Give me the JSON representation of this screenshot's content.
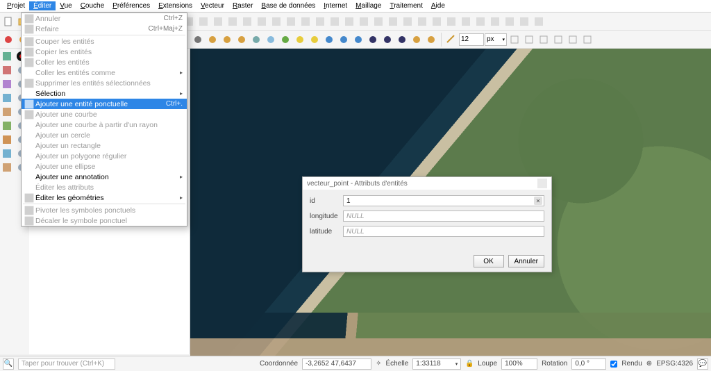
{
  "menubar": [
    {
      "label": "Projet",
      "active": false
    },
    {
      "label": "Éditer",
      "active": true
    },
    {
      "label": "Vue",
      "active": false
    },
    {
      "label": "Couche",
      "active": false
    },
    {
      "label": "Préférences",
      "active": false
    },
    {
      "label": "Extensions",
      "active": false
    },
    {
      "label": "Vecteur",
      "active": false
    },
    {
      "label": "Raster",
      "active": false
    },
    {
      "label": "Base de données",
      "active": false
    },
    {
      "label": "Internet",
      "active": false
    },
    {
      "label": "Maillage",
      "active": false
    },
    {
      "label": "Traitement",
      "active": false
    },
    {
      "label": "Aide",
      "active": false
    }
  ],
  "dropdown": {
    "items": [
      {
        "label": "Annuler",
        "shortcut": "Ctrl+Z",
        "disabled": true,
        "icon": "undo"
      },
      {
        "label": "Refaire",
        "shortcut": "Ctrl+Maj+Z",
        "disabled": true,
        "icon": "redo"
      },
      {
        "type": "sep"
      },
      {
        "label": "Couper les entités",
        "disabled": true,
        "icon": "cut"
      },
      {
        "label": "Copier les entités",
        "disabled": true,
        "icon": "copy"
      },
      {
        "label": "Coller les entités",
        "disabled": true,
        "icon": "paste"
      },
      {
        "label": "Coller les entités comme",
        "disabled": true,
        "submenu": true
      },
      {
        "label": "Supprimer les entités sélectionnées",
        "disabled": true,
        "icon": "trash"
      },
      {
        "label": "Sélection",
        "disabled": false,
        "submenu": true
      },
      {
        "label": "Ajouter une entité ponctuelle",
        "shortcut": "Ctrl+.",
        "highlight": true,
        "icon": "point"
      },
      {
        "label": "Ajouter une courbe",
        "disabled": true,
        "icon": "arc"
      },
      {
        "label": "Ajouter une courbe à partir d'un rayon",
        "disabled": true
      },
      {
        "label": "Ajouter un cercle",
        "disabled": true
      },
      {
        "label": "Ajouter un rectangle",
        "disabled": true
      },
      {
        "label": "Ajouter un polygone régulier",
        "disabled": true
      },
      {
        "label": "Ajouter une ellipse",
        "disabled": true
      },
      {
        "label": "Ajouter une annotation",
        "disabled": false,
        "submenu": true
      },
      {
        "label": "Éditer les attributs",
        "disabled": true
      },
      {
        "label": "Éditer les géométries",
        "disabled": false,
        "submenu": true,
        "icon": "geom"
      },
      {
        "type": "sep"
      },
      {
        "label": "Pivoter les symboles ponctuels",
        "disabled": true,
        "icon": "rotate"
      },
      {
        "label": "Décaler le symbole ponctuel",
        "disabled": true,
        "icon": "offset"
      }
    ]
  },
  "dialog": {
    "title": "vecteur_point - Attributs d'entités",
    "fields": [
      {
        "name": "id",
        "value": "1",
        "null": false,
        "clearable": true
      },
      {
        "name": "longitude",
        "value": "NULL",
        "null": true
      },
      {
        "name": "latitude",
        "value": "NULL",
        "null": true
      }
    ],
    "ok": "OK",
    "cancel": "Annuler"
  },
  "toolbar": {
    "spin_value": "12",
    "unit": "px"
  },
  "statusbar": {
    "search_placeholder": "Taper pour trouver (Ctrl+K)",
    "coord_label": "Coordonnée",
    "coord_value": "-3,2652 47,6437",
    "scale_label": "Échelle",
    "scale_value": "1:33118",
    "loupe_label": "Loupe",
    "loupe_value": "100%",
    "rotation_label": "Rotation",
    "rotation_value": "0,0 °",
    "render_label": "Rendu",
    "crs": "EPSG:4326"
  }
}
